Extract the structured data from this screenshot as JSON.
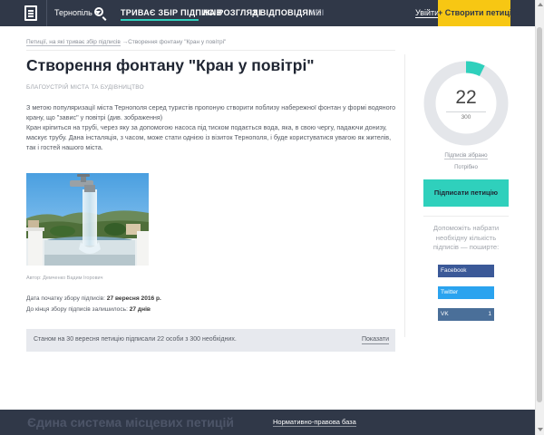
{
  "header": {
    "city": "Тернопіль",
    "nav": [
      {
        "label": "ТРИВАЄ ЗБІР ПІДПИСІВ",
        "active": true
      },
      {
        "label": "НА РОЗГЛЯДІ",
        "active": false
      },
      {
        "label": "З ВІДПОВІДЯМИ",
        "active": false
      },
      {
        "label": "УСІ",
        "active": false
      }
    ],
    "login": "Увійти",
    "create_button": "Створити петицію"
  },
  "breadcrumb": {
    "parent": "Петиції, на які триває збір підписів",
    "arrow": "→",
    "current": "Створення фонтану \"Кран у повітрі\""
  },
  "petition": {
    "title": "Створення фонтану \"Кран у повітрі\"",
    "category": "БЛАГОУСТРІЙ МІСТА ТА БУДІВНИЦТВО",
    "description": [
      "З метою популяризації міста Тернополя серед туристів пропоную створити поблизу набережної фонтан у формі водяного крану, що \"завис\" у повітрі (див. зображення)",
      "Кран кріпиться на трубі, через яку за допомогою насоса під тиском подається вода, яка, в свою чергу, падаючи донизу, маскує трубу. Дана інсталяція, з часом, може стати однією із візиток Тернополя, і буде користуватися увагою як жителів, так і гостей нашого міста."
    ],
    "photo_caption": "Автор: Демченко Вадим Ігорович",
    "start_label": "Дата початку збору підписів:",
    "start_date": "27 вересня 2016 р.",
    "remaining_label": "До кінця збору підписів залишилось:",
    "remaining": "27 днів",
    "status_text": "Станом на 30 вересня петицію підписали 22 особи з 300 необхідних.",
    "show_link": "Показати"
  },
  "sidebar": {
    "signatures": "22",
    "needed": "300",
    "progress_fraction": 0.0733,
    "collected_label": "Підписів зібрано",
    "needed_label": "Потрібно",
    "sign_button": "Підписати петицію",
    "share_text": "Допоможіть набрати необхідну кількість підписів — поширте:",
    "share": [
      {
        "network": "Facebook"
      },
      {
        "network": "Twitter"
      },
      {
        "network": "VK",
        "count": "1"
      }
    ]
  },
  "footer": {
    "title": "Єдина система місцевих петицій",
    "link": "Нормативно-правова база"
  },
  "colors": {
    "header_bg": "#303848",
    "accent": "#2fd0bc",
    "create_btn": "#f7c713"
  }
}
